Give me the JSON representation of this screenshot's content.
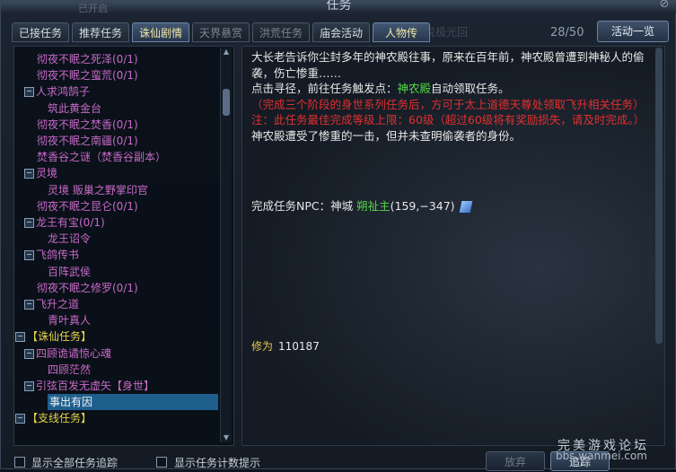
{
  "window": {
    "title": "任务",
    "close_icon": "close-icon"
  },
  "bg_text": {
    "top": "已开启",
    "mid": "传说极光回"
  },
  "tabs": [
    {
      "label": "已接任务",
      "state": "normal"
    },
    {
      "label": "推荐任务",
      "state": "normal"
    },
    {
      "label": "诛仙剧情",
      "state": "active"
    },
    {
      "label": "天界悬赏",
      "state": "dim"
    },
    {
      "label": "洪荒任务",
      "state": "dim"
    },
    {
      "label": "庙会活动",
      "state": "normal"
    },
    {
      "label": "人物传",
      "state": "active"
    }
  ],
  "counter": "28/50",
  "overview_button": "活动一览",
  "tree": [
    {
      "label": "彻夜不眠之死泽(0/1)",
      "kind": "q"
    },
    {
      "label": "彻夜不眠之蛮荒(0/1)",
      "kind": "q"
    },
    {
      "label": "人求鸿鹄子",
      "kind": "q",
      "toggle": "−"
    },
    {
      "label": "筑此黄金台",
      "kind": "q"
    },
    {
      "label": "彻夜不眠之焚香(0/1)",
      "kind": "q"
    },
    {
      "label": "彻夜不眠之南疆(0/1)",
      "kind": "q"
    },
    {
      "label": "焚香谷之谜（焚香谷副本）",
      "kind": "q"
    },
    {
      "label": "灵境",
      "kind": "q",
      "toggle": "−"
    },
    {
      "label": "灵境 贩巢之野掌印官",
      "kind": "q"
    },
    {
      "label": "彻夜不眠之昆仑(0/1)",
      "kind": "q"
    },
    {
      "label": "龙王有宝(0/1)",
      "kind": "q",
      "toggle": "−"
    },
    {
      "label": "龙王诏令",
      "kind": "q"
    },
    {
      "label": "飞鸽传书",
      "kind": "q",
      "toggle": "−"
    },
    {
      "label": "百阵武侯",
      "kind": "q"
    },
    {
      "label": "彻夜不眠之修罗(0/1)",
      "kind": "q"
    },
    {
      "label": "飞升之道",
      "kind": "q",
      "toggle": "−"
    },
    {
      "label": "青叶真人",
      "kind": "q"
    },
    {
      "label": "【诛仙任务】",
      "kind": "cat",
      "toggle": "−"
    },
    {
      "label": "四顾诡谲惊心魂",
      "kind": "q",
      "toggle": "−"
    },
    {
      "label": "四顾茫然",
      "kind": "q"
    },
    {
      "label": "引弦百发无虚矢【身世】",
      "kind": "q",
      "toggle": "−"
    },
    {
      "label": "事出有因",
      "kind": "sel"
    },
    {
      "label": "【支线任务】",
      "kind": "cat",
      "toggle": "−"
    }
  ],
  "description": {
    "p1": "大长老告诉你尘封多年的神农殿往事，原来在百年前，神农殿曾遭到神秘人的偷袭，伤亡惨重……",
    "p2_pre": "点击寻径，前往任务触发点：",
    "p2_link": "神农殿",
    "p2_post": "自动领取任务。",
    "p3": "（完成三个阶段的身世系列任务后，方可于太上道德天尊处领取飞升相关任务）",
    "p4": "注：此任务最佳完成等级上限：60级（超过60级将有奖励损失，请及时完成。）",
    "p5": "神农殿遭受了惨重的一击，但并未查明偷袭者的身份。"
  },
  "npc": {
    "label": "完成任务NPC：神城 ",
    "name": "朔祉主",
    "coords": "(159,−347)",
    "icon": "pathfind-icon"
  },
  "reward": {
    "label": "修为",
    "value": "110187"
  },
  "footer": {
    "check1": "显示全部任务追踪",
    "check2": "显示任务计数提示",
    "abandon": "放弃",
    "track": "追踪"
  },
  "watermark": {
    "line1": "完美游戏论坛",
    "line2": "bbs.wanmei.com"
  }
}
